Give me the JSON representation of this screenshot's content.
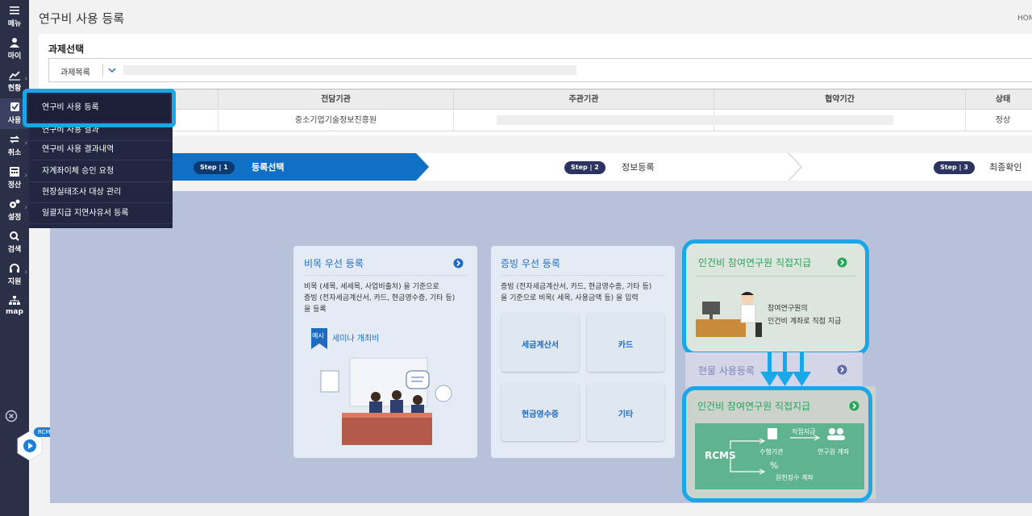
{
  "header": {
    "title": "연구비 사용 등록",
    "home": "HOM"
  },
  "sidebar": {
    "items": [
      {
        "label": "메뉴",
        "icon": "hamburger-icon"
      },
      {
        "label": "마이",
        "icon": "user-icon"
      },
      {
        "label": "현황",
        "icon": "chart-icon"
      },
      {
        "label": "사용",
        "icon": "checkbox-icon"
      },
      {
        "label": "취소",
        "icon": "refresh-icon"
      },
      {
        "label": "정산",
        "icon": "calculator-icon"
      },
      {
        "label": "설정",
        "icon": "gear-icon"
      },
      {
        "label": "검색",
        "icon": "search-icon"
      },
      {
        "label": "지원",
        "icon": "headset-icon"
      },
      {
        "label": "map",
        "icon": "sitemap-icon"
      }
    ],
    "rcms_badge": "RCMS 챗봇"
  },
  "dropdown": {
    "items": [
      "연구비 사용 등록",
      "연구비 사용 결과내역",
      "자계좌이체 승인 요청",
      "현장실태조사 대상 관리",
      "일괄지급 지연사유서 등록"
    ],
    "hidden_item": "연구비 사용 결과"
  },
  "project": {
    "section_title": "과제선택",
    "select_label": "과제목록",
    "columns": [
      "전담기관",
      "주관기관",
      "협약기간",
      "상태"
    ],
    "row": {
      "agency": "중소기업기술정보진흥원",
      "status": "정상"
    }
  },
  "steps": [
    {
      "badge": "Step",
      "num": "1",
      "label": "등록선택"
    },
    {
      "badge": "Step",
      "num": "2",
      "label": "정보등록"
    },
    {
      "badge": "Step",
      "num": "3",
      "label": "최종확인"
    }
  ],
  "cards": {
    "bimok": {
      "title": "비목 우선 등록",
      "desc_line1": "비목 (세목, 세세목, 사업비출처) 을 기준으로",
      "desc_line2": "증빙 (전자세금계산서, 카드, 현금영수증, 기타 등)",
      "desc_line3": "을 등록",
      "example_tag": "예시",
      "example": "세미나 개최비"
    },
    "jeungbing": {
      "title": "증빙 우선 등록",
      "desc_line1": "증빙 (전자세금계산서, 카드, 현금영수증, 기타 등)",
      "desc_line2": "을 기준으로 비목( 세목, 사용금액 등) 을 입력",
      "tiles": [
        "세금계산서",
        "카드",
        "현금영수증",
        "기타"
      ]
    },
    "ingeonbi_top": {
      "title": "인건비 참여연구원 직접지급",
      "desc_line1": "참여연구원의",
      "desc_line2": "인건비 계좌로 직접 지급"
    },
    "hyunmul": {
      "title": "현물 사용등록"
    },
    "ingeonbi_bottom": {
      "title": "인건비 참여연구원 직접지급",
      "rcms": "RCMS",
      "org": "수행기관",
      "direct": "직접지급",
      "researcher": "연구원 계좌",
      "tax": "원천징수 계좌"
    }
  },
  "colors": {
    "accent": "#1aa7e8",
    "step_active": "#1170c4",
    "sidebar": "#2c2f48",
    "green": "#27a55b"
  }
}
